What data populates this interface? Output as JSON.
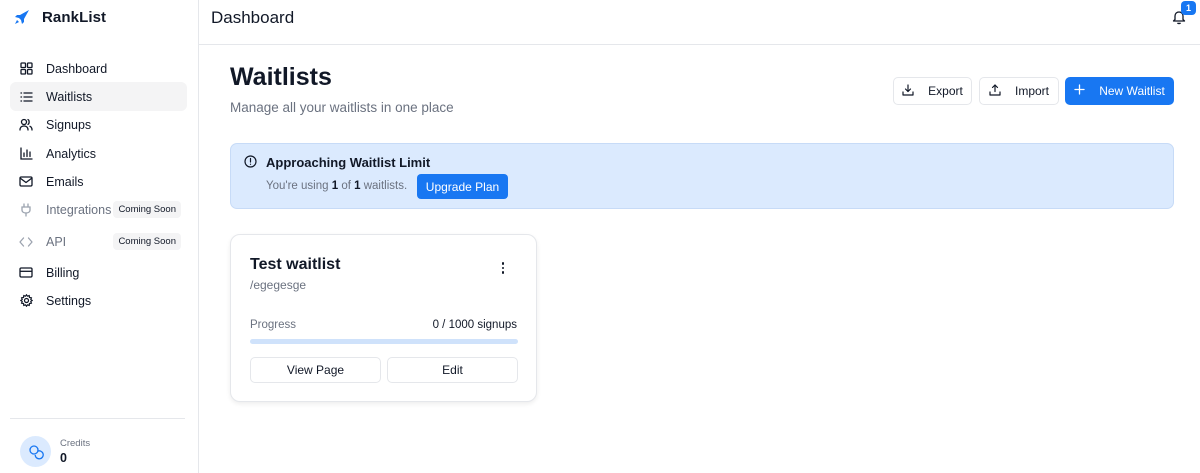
{
  "app": {
    "name": "RankList"
  },
  "header": {
    "title": "Dashboard",
    "notification_count": "1"
  },
  "sidebar": {
    "items": [
      {
        "label": "Dashboard",
        "icon": "dashboard-grid-icon"
      },
      {
        "label": "Waitlists",
        "icon": "list-icon",
        "active": true
      },
      {
        "label": "Signups",
        "icon": "users-icon"
      },
      {
        "label": "Analytics",
        "icon": "bar-chart-icon"
      },
      {
        "label": "Emails",
        "icon": "mail-icon"
      },
      {
        "label": "Integrations",
        "icon": "plug-icon",
        "badge": "Coming Soon",
        "disabled": true
      },
      {
        "label": "API",
        "icon": "code-icon",
        "badge": "Coming Soon",
        "disabled": true
      },
      {
        "label": "Billing",
        "icon": "credit-card-icon"
      },
      {
        "label": "Settings",
        "icon": "gear-icon"
      }
    ],
    "credits": {
      "label": "Credits",
      "value": "0"
    }
  },
  "main": {
    "title": "Waitlists",
    "subtitle": "Manage all your waitlists in one place",
    "actions": {
      "export_label": "Export",
      "import_label": "Import",
      "new_label": "New Waitlist"
    },
    "alert": {
      "title": "Approaching Waitlist Limit",
      "text_prefix": "You're using ",
      "used": "1",
      "text_middle": " of ",
      "limit": "1",
      "text_suffix": " waitlists.",
      "button_label": "Upgrade Plan"
    },
    "waitlists": [
      {
        "name": "Test waitlist",
        "slug": "/egegesge",
        "progress_label": "Progress",
        "progress_text": "0 / 1000 signups",
        "progress_fraction": 0,
        "view_label": "View Page",
        "edit_label": "Edit"
      }
    ]
  },
  "colors": {
    "accent": "#1877f2",
    "alert_bg": "#dbeafe",
    "active_nav_bg": "#f4f4f5"
  }
}
